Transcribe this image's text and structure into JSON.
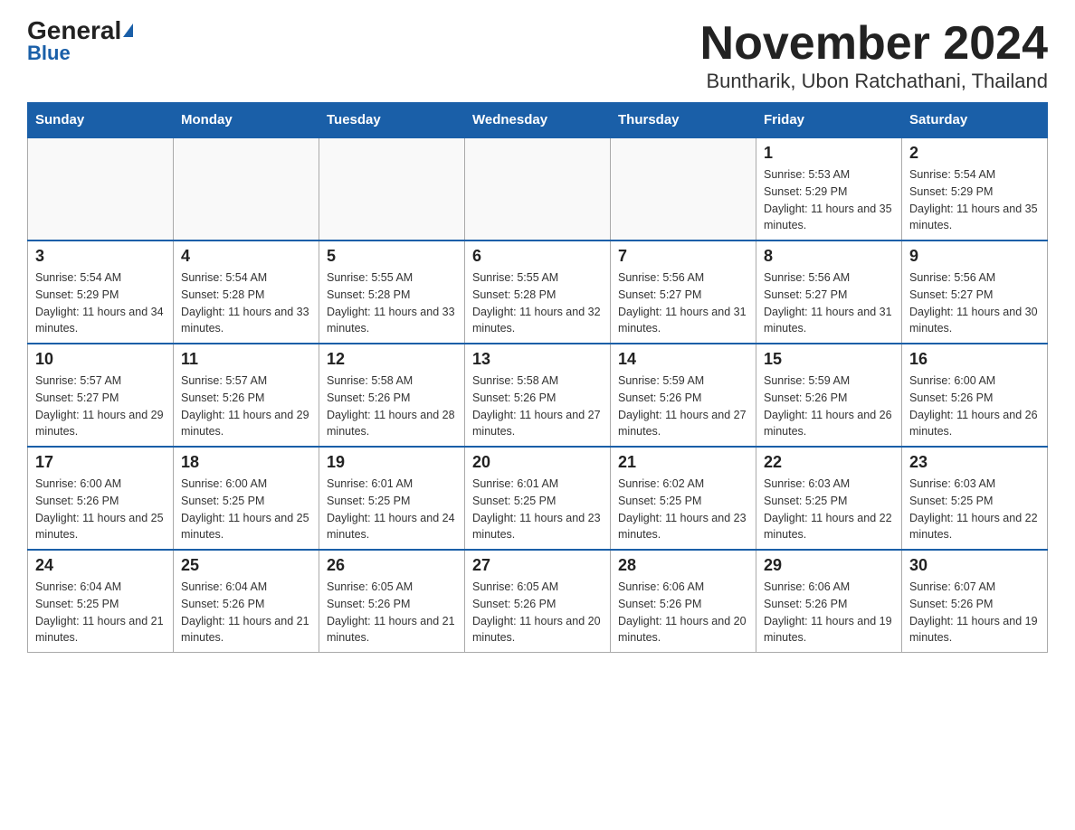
{
  "logo": {
    "general": "General",
    "triangle": "▶",
    "blue": "Blue"
  },
  "header": {
    "month_year": "November 2024",
    "location": "Buntharik, Ubon Ratchathani, Thailand"
  },
  "weekdays": [
    "Sunday",
    "Monday",
    "Tuesday",
    "Wednesday",
    "Thursday",
    "Friday",
    "Saturday"
  ],
  "weeks": [
    [
      {
        "day": "",
        "sunrise": "",
        "sunset": "",
        "daylight": "",
        "empty": true
      },
      {
        "day": "",
        "sunrise": "",
        "sunset": "",
        "daylight": "",
        "empty": true
      },
      {
        "day": "",
        "sunrise": "",
        "sunset": "",
        "daylight": "",
        "empty": true
      },
      {
        "day": "",
        "sunrise": "",
        "sunset": "",
        "daylight": "",
        "empty": true
      },
      {
        "day": "",
        "sunrise": "",
        "sunset": "",
        "daylight": "",
        "empty": true
      },
      {
        "day": "1",
        "sunrise": "Sunrise: 5:53 AM",
        "sunset": "Sunset: 5:29 PM",
        "daylight": "Daylight: 11 hours and 35 minutes.",
        "empty": false
      },
      {
        "day": "2",
        "sunrise": "Sunrise: 5:54 AM",
        "sunset": "Sunset: 5:29 PM",
        "daylight": "Daylight: 11 hours and 35 minutes.",
        "empty": false
      }
    ],
    [
      {
        "day": "3",
        "sunrise": "Sunrise: 5:54 AM",
        "sunset": "Sunset: 5:29 PM",
        "daylight": "Daylight: 11 hours and 34 minutes.",
        "empty": false
      },
      {
        "day": "4",
        "sunrise": "Sunrise: 5:54 AM",
        "sunset": "Sunset: 5:28 PM",
        "daylight": "Daylight: 11 hours and 33 minutes.",
        "empty": false
      },
      {
        "day": "5",
        "sunrise": "Sunrise: 5:55 AM",
        "sunset": "Sunset: 5:28 PM",
        "daylight": "Daylight: 11 hours and 33 minutes.",
        "empty": false
      },
      {
        "day": "6",
        "sunrise": "Sunrise: 5:55 AM",
        "sunset": "Sunset: 5:28 PM",
        "daylight": "Daylight: 11 hours and 32 minutes.",
        "empty": false
      },
      {
        "day": "7",
        "sunrise": "Sunrise: 5:56 AM",
        "sunset": "Sunset: 5:27 PM",
        "daylight": "Daylight: 11 hours and 31 minutes.",
        "empty": false
      },
      {
        "day": "8",
        "sunrise": "Sunrise: 5:56 AM",
        "sunset": "Sunset: 5:27 PM",
        "daylight": "Daylight: 11 hours and 31 minutes.",
        "empty": false
      },
      {
        "day": "9",
        "sunrise": "Sunrise: 5:56 AM",
        "sunset": "Sunset: 5:27 PM",
        "daylight": "Daylight: 11 hours and 30 minutes.",
        "empty": false
      }
    ],
    [
      {
        "day": "10",
        "sunrise": "Sunrise: 5:57 AM",
        "sunset": "Sunset: 5:27 PM",
        "daylight": "Daylight: 11 hours and 29 minutes.",
        "empty": false
      },
      {
        "day": "11",
        "sunrise": "Sunrise: 5:57 AM",
        "sunset": "Sunset: 5:26 PM",
        "daylight": "Daylight: 11 hours and 29 minutes.",
        "empty": false
      },
      {
        "day": "12",
        "sunrise": "Sunrise: 5:58 AM",
        "sunset": "Sunset: 5:26 PM",
        "daylight": "Daylight: 11 hours and 28 minutes.",
        "empty": false
      },
      {
        "day": "13",
        "sunrise": "Sunrise: 5:58 AM",
        "sunset": "Sunset: 5:26 PM",
        "daylight": "Daylight: 11 hours and 27 minutes.",
        "empty": false
      },
      {
        "day": "14",
        "sunrise": "Sunrise: 5:59 AM",
        "sunset": "Sunset: 5:26 PM",
        "daylight": "Daylight: 11 hours and 27 minutes.",
        "empty": false
      },
      {
        "day": "15",
        "sunrise": "Sunrise: 5:59 AM",
        "sunset": "Sunset: 5:26 PM",
        "daylight": "Daylight: 11 hours and 26 minutes.",
        "empty": false
      },
      {
        "day": "16",
        "sunrise": "Sunrise: 6:00 AM",
        "sunset": "Sunset: 5:26 PM",
        "daylight": "Daylight: 11 hours and 26 minutes.",
        "empty": false
      }
    ],
    [
      {
        "day": "17",
        "sunrise": "Sunrise: 6:00 AM",
        "sunset": "Sunset: 5:26 PM",
        "daylight": "Daylight: 11 hours and 25 minutes.",
        "empty": false
      },
      {
        "day": "18",
        "sunrise": "Sunrise: 6:00 AM",
        "sunset": "Sunset: 5:25 PM",
        "daylight": "Daylight: 11 hours and 25 minutes.",
        "empty": false
      },
      {
        "day": "19",
        "sunrise": "Sunrise: 6:01 AM",
        "sunset": "Sunset: 5:25 PM",
        "daylight": "Daylight: 11 hours and 24 minutes.",
        "empty": false
      },
      {
        "day": "20",
        "sunrise": "Sunrise: 6:01 AM",
        "sunset": "Sunset: 5:25 PM",
        "daylight": "Daylight: 11 hours and 23 minutes.",
        "empty": false
      },
      {
        "day": "21",
        "sunrise": "Sunrise: 6:02 AM",
        "sunset": "Sunset: 5:25 PM",
        "daylight": "Daylight: 11 hours and 23 minutes.",
        "empty": false
      },
      {
        "day": "22",
        "sunrise": "Sunrise: 6:03 AM",
        "sunset": "Sunset: 5:25 PM",
        "daylight": "Daylight: 11 hours and 22 minutes.",
        "empty": false
      },
      {
        "day": "23",
        "sunrise": "Sunrise: 6:03 AM",
        "sunset": "Sunset: 5:25 PM",
        "daylight": "Daylight: 11 hours and 22 minutes.",
        "empty": false
      }
    ],
    [
      {
        "day": "24",
        "sunrise": "Sunrise: 6:04 AM",
        "sunset": "Sunset: 5:25 PM",
        "daylight": "Daylight: 11 hours and 21 minutes.",
        "empty": false
      },
      {
        "day": "25",
        "sunrise": "Sunrise: 6:04 AM",
        "sunset": "Sunset: 5:26 PM",
        "daylight": "Daylight: 11 hours and 21 minutes.",
        "empty": false
      },
      {
        "day": "26",
        "sunrise": "Sunrise: 6:05 AM",
        "sunset": "Sunset: 5:26 PM",
        "daylight": "Daylight: 11 hours and 21 minutes.",
        "empty": false
      },
      {
        "day": "27",
        "sunrise": "Sunrise: 6:05 AM",
        "sunset": "Sunset: 5:26 PM",
        "daylight": "Daylight: 11 hours and 20 minutes.",
        "empty": false
      },
      {
        "day": "28",
        "sunrise": "Sunrise: 6:06 AM",
        "sunset": "Sunset: 5:26 PM",
        "daylight": "Daylight: 11 hours and 20 minutes.",
        "empty": false
      },
      {
        "day": "29",
        "sunrise": "Sunrise: 6:06 AM",
        "sunset": "Sunset: 5:26 PM",
        "daylight": "Daylight: 11 hours and 19 minutes.",
        "empty": false
      },
      {
        "day": "30",
        "sunrise": "Sunrise: 6:07 AM",
        "sunset": "Sunset: 5:26 PM",
        "daylight": "Daylight: 11 hours and 19 minutes.",
        "empty": false
      }
    ]
  ]
}
